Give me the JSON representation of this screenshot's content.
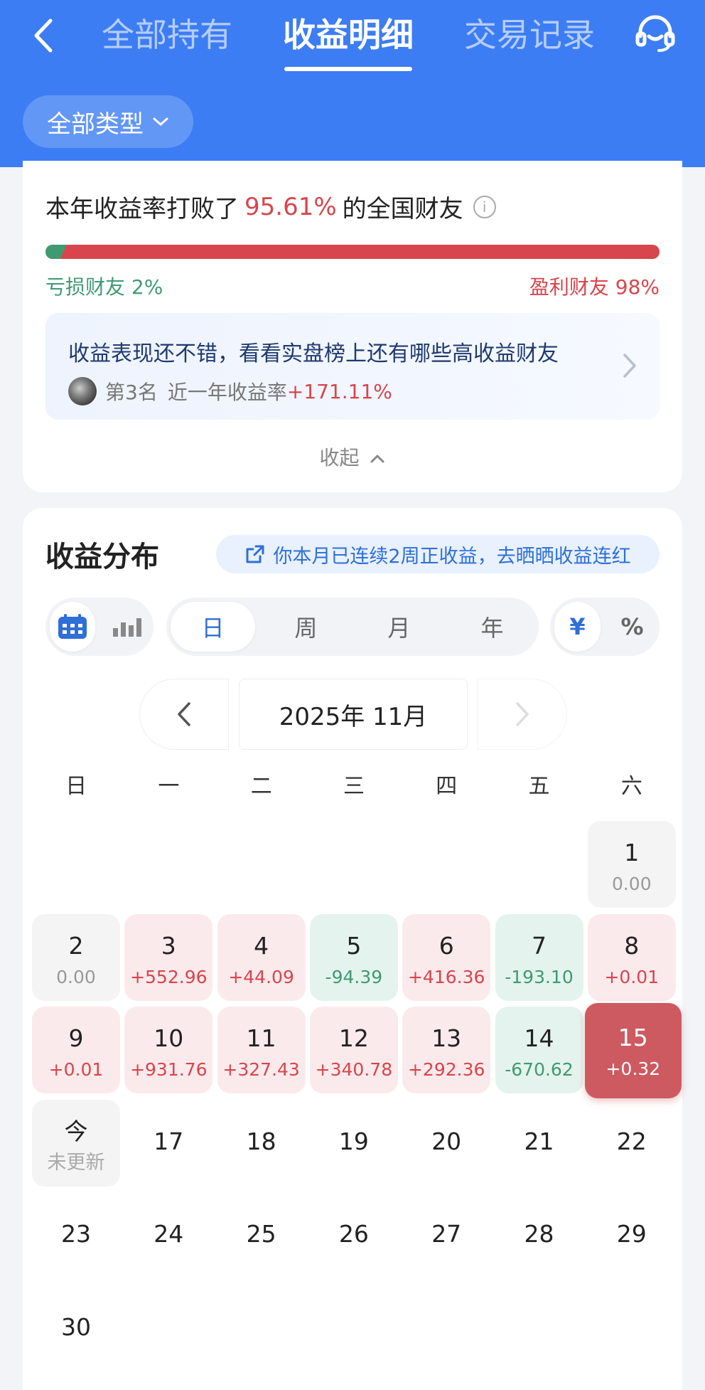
{
  "header": {
    "tabs": [
      "全部持有",
      "收益明细",
      "交易记录"
    ],
    "active_tab": 1,
    "filter_label": "全部类型",
    "bg_color": "#3d7df3"
  },
  "ranking": {
    "title_prefix": "本年收益率打败了",
    "percent": "95.61%",
    "title_suffix": "的全国财友",
    "loss_label": "亏损财友 2%",
    "win_label": "盈利财友 98%",
    "loss_ratio": 0.02,
    "promo_title": "收益表现还不错，看看实盘榜上还有哪些高收益财友",
    "promo_rank": "第3名",
    "promo_rate_label": "近一年收益率",
    "promo_rate_value": "+171.11%",
    "collapse_label": "收起"
  },
  "distribution": {
    "title": "收益分布",
    "streak_text": "你本月已连续2周正收益，去晒晒收益连红",
    "period_tabs": [
      "日",
      "周",
      "月",
      "年"
    ],
    "active_period": 0,
    "unit_tabs": [
      "¥",
      "%"
    ],
    "active_unit": 0,
    "active_view": "calendar",
    "month_label": "2025年 11月",
    "weekdays": [
      "日",
      "一",
      "二",
      "三",
      "四",
      "五",
      "六"
    ]
  },
  "calendar": {
    "first_weekday": 6,
    "days": [
      {
        "day": "1",
        "value": "0.00",
        "state": "neutral"
      },
      {
        "day": "2",
        "value": "0.00",
        "state": "neutral"
      },
      {
        "day": "3",
        "value": "+552.96",
        "state": "up"
      },
      {
        "day": "4",
        "value": "+44.09",
        "state": "up"
      },
      {
        "day": "5",
        "value": "-94.39",
        "state": "down"
      },
      {
        "day": "6",
        "value": "+416.36",
        "state": "up"
      },
      {
        "day": "7",
        "value": "-193.10",
        "state": "down"
      },
      {
        "day": "8",
        "value": "+0.01",
        "state": "up"
      },
      {
        "day": "9",
        "value": "+0.01",
        "state": "up"
      },
      {
        "day": "10",
        "value": "+931.76",
        "state": "up"
      },
      {
        "day": "11",
        "value": "+327.43",
        "state": "up"
      },
      {
        "day": "12",
        "value": "+340.78",
        "state": "up"
      },
      {
        "day": "13",
        "value": "+292.36",
        "state": "up"
      },
      {
        "day": "14",
        "value": "-670.62",
        "state": "down"
      },
      {
        "day": "15",
        "value": "+0.32",
        "state": "selected"
      },
      {
        "day": "今",
        "value": "未更新",
        "state": "today"
      },
      {
        "day": "17",
        "value": "",
        "state": "empty"
      },
      {
        "day": "18",
        "value": "",
        "state": "empty"
      },
      {
        "day": "19",
        "value": "",
        "state": "empty"
      },
      {
        "day": "20",
        "value": "",
        "state": "empty"
      },
      {
        "day": "21",
        "value": "",
        "state": "empty"
      },
      {
        "day": "22",
        "value": "",
        "state": "empty"
      },
      {
        "day": "23",
        "value": "",
        "state": "empty"
      },
      {
        "day": "24",
        "value": "",
        "state": "empty"
      },
      {
        "day": "25",
        "value": "",
        "state": "empty"
      },
      {
        "day": "26",
        "value": "",
        "state": "empty"
      },
      {
        "day": "27",
        "value": "",
        "state": "empty"
      },
      {
        "day": "28",
        "value": "",
        "state": "empty"
      },
      {
        "day": "29",
        "value": "",
        "state": "empty"
      },
      {
        "day": "30",
        "value": "",
        "state": "empty"
      }
    ]
  },
  "colors": {
    "accent": "#2e6fd9",
    "profit": "#d8454c",
    "loss": "#3f9a72"
  },
  "icons": {
    "back": "chevron-left-icon",
    "service": "headset-icon",
    "filter_arrow": "chevron-down-icon",
    "info": "info-icon",
    "promo_arrow": "chevron-right-icon",
    "collapse": "chevron-up-icon",
    "streak": "share-icon",
    "calendar_view": "calendar-icon",
    "bar_view": "bar-chart-icon",
    "prev_month": "chevron-left-icon",
    "next_month": "chevron-right-icon"
  }
}
